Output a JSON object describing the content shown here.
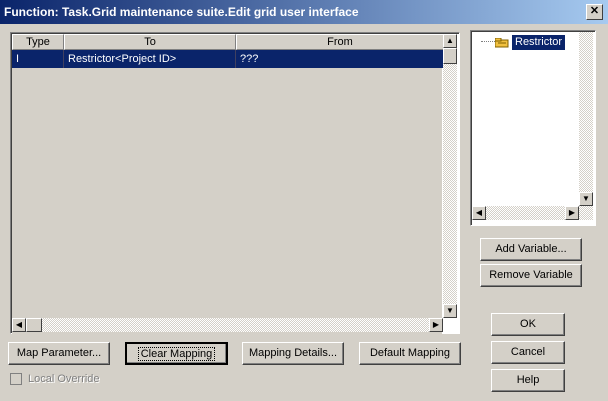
{
  "window": {
    "title": "Function: Task.Grid maintenance suite.Edit grid user interface",
    "close_label": "✕"
  },
  "grid": {
    "columns": [
      "Type",
      "To",
      "From"
    ],
    "rows": [
      {
        "type": "I",
        "to": "Restrictor<Project ID>",
        "from": "???"
      }
    ]
  },
  "tree": {
    "items": [
      {
        "label": "Restrictor",
        "icon": "folder-key-icon"
      }
    ]
  },
  "buttons": {
    "add_variable": "Add Variable...",
    "remove_variable": "Remove Variable",
    "map_parameter": "Map Parameter...",
    "clear_mapping": "Clear Mapping",
    "mapping_details": "Mapping Details...",
    "default_mapping": "Default Mapping",
    "ok": "OK",
    "cancel": "Cancel",
    "help": "Help"
  },
  "local_override": {
    "label": "Local Override",
    "checked": false,
    "enabled": false
  },
  "colors": {
    "titlebar_start": "#0a246a",
    "titlebar_end": "#a6caf0",
    "selection": "#0a246a",
    "face": "#d4d0c8"
  }
}
